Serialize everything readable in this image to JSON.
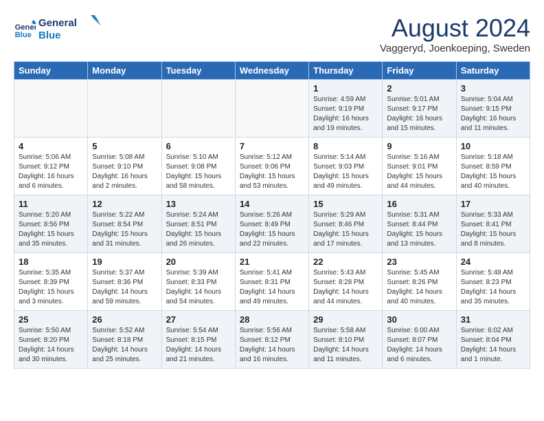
{
  "header": {
    "logo_line1": "General",
    "logo_line2": "Blue",
    "month": "August 2024",
    "location": "Vaggeryd, Joenkoeping, Sweden"
  },
  "weekdays": [
    "Sunday",
    "Monday",
    "Tuesday",
    "Wednesday",
    "Thursday",
    "Friday",
    "Saturday"
  ],
  "weeks": [
    [
      {
        "day": "",
        "content": ""
      },
      {
        "day": "",
        "content": ""
      },
      {
        "day": "",
        "content": ""
      },
      {
        "day": "",
        "content": ""
      },
      {
        "day": "1",
        "content": "Sunrise: 4:59 AM\nSunset: 9:19 PM\nDaylight: 16 hours\nand 19 minutes."
      },
      {
        "day": "2",
        "content": "Sunrise: 5:01 AM\nSunset: 9:17 PM\nDaylight: 16 hours\nand 15 minutes."
      },
      {
        "day": "3",
        "content": "Sunrise: 5:04 AM\nSunset: 9:15 PM\nDaylight: 16 hours\nand 11 minutes."
      }
    ],
    [
      {
        "day": "4",
        "content": "Sunrise: 5:06 AM\nSunset: 9:12 PM\nDaylight: 16 hours\nand 6 minutes."
      },
      {
        "day": "5",
        "content": "Sunrise: 5:08 AM\nSunset: 9:10 PM\nDaylight: 16 hours\nand 2 minutes."
      },
      {
        "day": "6",
        "content": "Sunrise: 5:10 AM\nSunset: 9:08 PM\nDaylight: 15 hours\nand 58 minutes."
      },
      {
        "day": "7",
        "content": "Sunrise: 5:12 AM\nSunset: 9:06 PM\nDaylight: 15 hours\nand 53 minutes."
      },
      {
        "day": "8",
        "content": "Sunrise: 5:14 AM\nSunset: 9:03 PM\nDaylight: 15 hours\nand 49 minutes."
      },
      {
        "day": "9",
        "content": "Sunrise: 5:16 AM\nSunset: 9:01 PM\nDaylight: 15 hours\nand 44 minutes."
      },
      {
        "day": "10",
        "content": "Sunrise: 5:18 AM\nSunset: 8:59 PM\nDaylight: 15 hours\nand 40 minutes."
      }
    ],
    [
      {
        "day": "11",
        "content": "Sunrise: 5:20 AM\nSunset: 8:56 PM\nDaylight: 15 hours\nand 35 minutes."
      },
      {
        "day": "12",
        "content": "Sunrise: 5:22 AM\nSunset: 8:54 PM\nDaylight: 15 hours\nand 31 minutes."
      },
      {
        "day": "13",
        "content": "Sunrise: 5:24 AM\nSunset: 8:51 PM\nDaylight: 15 hours\nand 26 minutes."
      },
      {
        "day": "14",
        "content": "Sunrise: 5:26 AM\nSunset: 8:49 PM\nDaylight: 15 hours\nand 22 minutes."
      },
      {
        "day": "15",
        "content": "Sunrise: 5:29 AM\nSunset: 8:46 PM\nDaylight: 15 hours\nand 17 minutes."
      },
      {
        "day": "16",
        "content": "Sunrise: 5:31 AM\nSunset: 8:44 PM\nDaylight: 15 hours\nand 13 minutes."
      },
      {
        "day": "17",
        "content": "Sunrise: 5:33 AM\nSunset: 8:41 PM\nDaylight: 15 hours\nand 8 minutes."
      }
    ],
    [
      {
        "day": "18",
        "content": "Sunrise: 5:35 AM\nSunset: 8:39 PM\nDaylight: 15 hours\nand 3 minutes."
      },
      {
        "day": "19",
        "content": "Sunrise: 5:37 AM\nSunset: 8:36 PM\nDaylight: 14 hours\nand 59 minutes."
      },
      {
        "day": "20",
        "content": "Sunrise: 5:39 AM\nSunset: 8:33 PM\nDaylight: 14 hours\nand 54 minutes."
      },
      {
        "day": "21",
        "content": "Sunrise: 5:41 AM\nSunset: 8:31 PM\nDaylight: 14 hours\nand 49 minutes."
      },
      {
        "day": "22",
        "content": "Sunrise: 5:43 AM\nSunset: 8:28 PM\nDaylight: 14 hours\nand 44 minutes."
      },
      {
        "day": "23",
        "content": "Sunrise: 5:45 AM\nSunset: 8:26 PM\nDaylight: 14 hours\nand 40 minutes."
      },
      {
        "day": "24",
        "content": "Sunrise: 5:48 AM\nSunset: 8:23 PM\nDaylight: 14 hours\nand 35 minutes."
      }
    ],
    [
      {
        "day": "25",
        "content": "Sunrise: 5:50 AM\nSunset: 8:20 PM\nDaylight: 14 hours\nand 30 minutes."
      },
      {
        "day": "26",
        "content": "Sunrise: 5:52 AM\nSunset: 8:18 PM\nDaylight: 14 hours\nand 25 minutes."
      },
      {
        "day": "27",
        "content": "Sunrise: 5:54 AM\nSunset: 8:15 PM\nDaylight: 14 hours\nand 21 minutes."
      },
      {
        "day": "28",
        "content": "Sunrise: 5:56 AM\nSunset: 8:12 PM\nDaylight: 14 hours\nand 16 minutes."
      },
      {
        "day": "29",
        "content": "Sunrise: 5:58 AM\nSunset: 8:10 PM\nDaylight: 14 hours\nand 11 minutes."
      },
      {
        "day": "30",
        "content": "Sunrise: 6:00 AM\nSunset: 8:07 PM\nDaylight: 14 hours\nand 6 minutes."
      },
      {
        "day": "31",
        "content": "Sunrise: 6:02 AM\nSunset: 8:04 PM\nDaylight: 14 hours\nand 1 minute."
      }
    ]
  ]
}
